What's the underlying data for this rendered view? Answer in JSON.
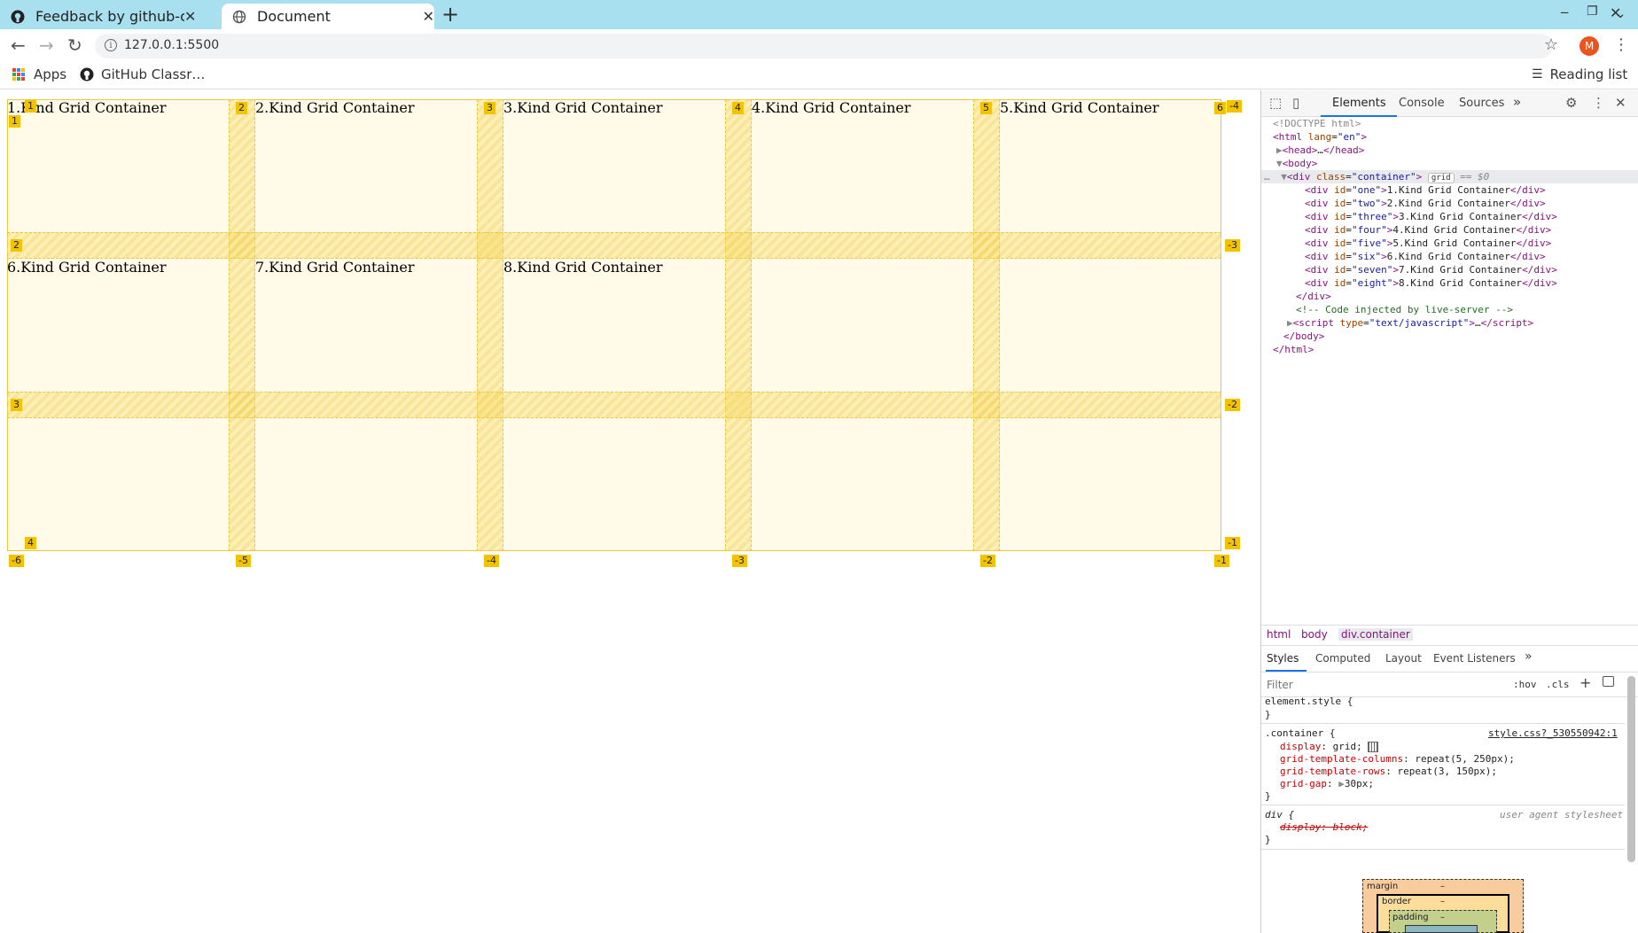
{
  "browser": {
    "tabs": [
      {
        "title": "Feedback by github-classr",
        "icon": "github-icon",
        "active": false
      },
      {
        "title": "Document",
        "icon": "globe-icon",
        "active": true
      }
    ],
    "url": "127.0.0.1:5500",
    "avatar_letter": "M",
    "bookmarks": {
      "apps": "Apps",
      "github": "GitHub Classr…",
      "reading_list": "Reading list"
    }
  },
  "page": {
    "cells": [
      "1.Kind Grid Container",
      "2.Kind Grid Container",
      "3.Kind Grid Container",
      "4.Kind Grid Container",
      "5.Kind Grid Container",
      "6.Kind Grid Container",
      "7.Kind Grid Container",
      "8.Kind Grid Container"
    ],
    "grid_overlay": {
      "col_lines_top": [
        "1",
        "2",
        "3",
        "4",
        "5",
        "6",
        "-4"
      ],
      "row_lines_left": [
        "1",
        "2",
        "3",
        "4"
      ],
      "row_lines_right": [
        "-3",
        "-2",
        "-1"
      ],
      "col_lines_bottom": [
        "-6",
        "-5",
        "-4",
        "-3",
        "-2",
        "-1"
      ]
    }
  },
  "devtools": {
    "tabs": [
      "Elements",
      "Console",
      "Sources"
    ],
    "more": "»",
    "dom": {
      "doctype": "<!DOCTYPE html>",
      "html_open": "html",
      "lang_attr": "lang",
      "lang_val": "\"en\"",
      "head": "head",
      "body": "body",
      "div_tag": "div",
      "class_attr": "class",
      "container_val": "\"container\"",
      "grid_badge": "grid",
      "eq": "== $0",
      "children": [
        {
          "id": "\"one\"",
          "text": "1.Kind Grid Container"
        },
        {
          "id": "\"two\"",
          "text": "2.Kind Grid Container"
        },
        {
          "id": "\"three\"",
          "text": "3.Kind Grid Container"
        },
        {
          "id": "\"four\"",
          "text": "4.Kind Grid Container"
        },
        {
          "id": "\"five\"",
          "text": "5.Kind Grid Container"
        },
        {
          "id": "\"six\"",
          "text": "6.Kind Grid Container"
        },
        {
          "id": "\"seven\"",
          "text": "7.Kind Grid Container"
        },
        {
          "id": "\"eight\"",
          "text": "8.Kind Grid Container"
        }
      ],
      "comment": "<!-- Code injected by live-server -->",
      "script_type": "\"text/javascript\""
    },
    "breadcrumb": [
      "html",
      "body",
      "div.container"
    ],
    "styles_tabs": [
      "Styles",
      "Computed",
      "Layout",
      "Event Listeners"
    ],
    "filter_placeholder": "Filter",
    "hov": ":hov",
    "cls": ".cls",
    "rules": {
      "element_style": "element.style {",
      "close": "}",
      "container_selector": ".container {",
      "source": "style.css?_530550942:1",
      "props": [
        {
          "name": "display",
          "value": "grid;"
        },
        {
          "name": "grid-template-columns",
          "value": "repeat(5, 250px);"
        },
        {
          "name": "grid-template-rows",
          "value": "repeat(3, 150px);"
        },
        {
          "name": "grid-gap",
          "value": "30px;"
        }
      ],
      "div_selector": "div {",
      "ua_label": "user agent stylesheet",
      "ua_prop": "display: block;"
    },
    "box_model": {
      "margin": "margin",
      "border": "border",
      "padding": "padding",
      "dash": "–"
    }
  }
}
